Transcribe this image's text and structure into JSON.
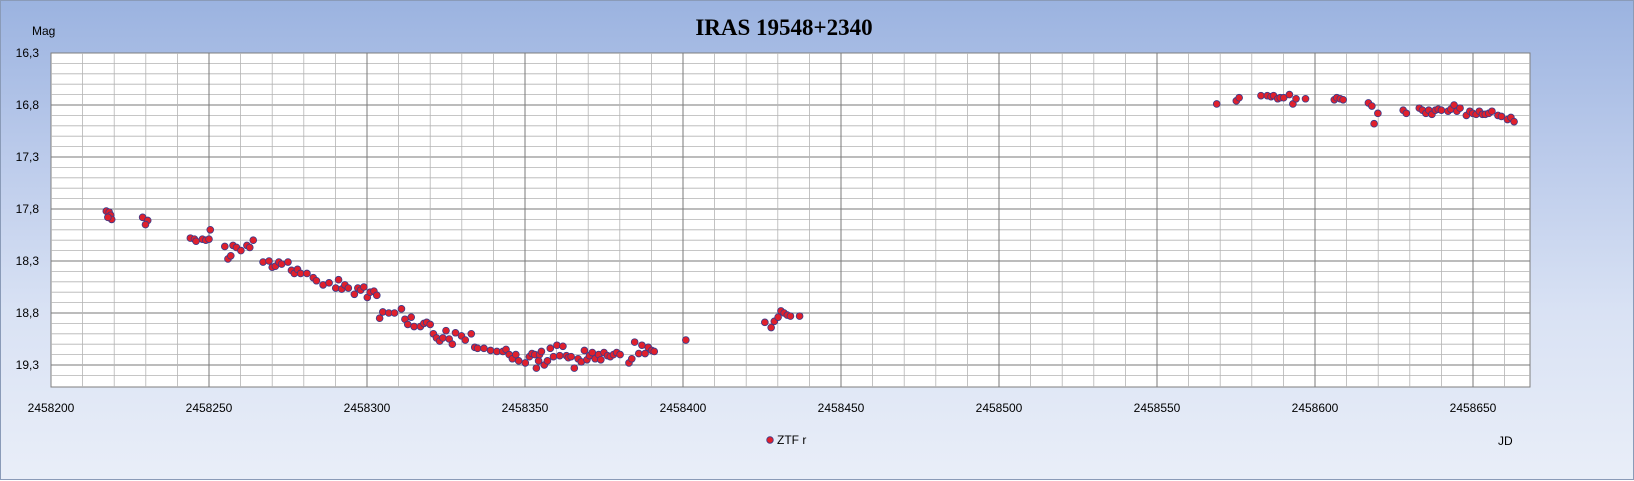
{
  "chart_data": {
    "type": "scatter",
    "title": "IRAS 19548+2340",
    "ylabel": "Mag",
    "xlabel": "JD",
    "y_inverted": true,
    "xlim": [
      2458200,
      2458670
    ],
    "ylim": [
      16.3,
      19.5
    ],
    "x_ticks": [
      "2458200",
      "2458250",
      "2458300",
      "2458350",
      "2458400",
      "2458450",
      "2458500",
      "2458550",
      "2458600",
      "2458650"
    ],
    "y_ticks": [
      "16,3",
      "16,8",
      "17,3",
      "17,8",
      "18,3",
      "18,8",
      "19,3"
    ],
    "grid": true,
    "legend_position": "bottom-center",
    "colors": {
      "marker": "#e0202c",
      "marker_edge": "#3a3a8a",
      "grid": "#9a9a9a",
      "plot_bg": "#ffffff"
    },
    "series": [
      {
        "name": "ZTF r",
        "x": [
          2458217.5,
          2458218.4,
          2458218.9,
          2458219.2,
          2458218.0,
          2458229.0,
          2458230.6,
          2458229.9,
          2458244.1,
          2458245.4,
          2458245.9,
          2458247.9,
          2458249.0,
          2458250.0,
          2458250.4,
          2458255.0,
          2458256.0,
          2458256.9,
          2458257.6,
          2458258.7,
          2458260.1,
          2458262.0,
          2458262.9,
          2458264.0,
          2458267.1,
          2458269.0,
          2458270.0,
          2458271.0,
          2458272.1,
          2458273.0,
          2458275.0,
          2458276.1,
          2458277.0,
          2458278.0,
          2458279.0,
          2458281.0,
          2458283.0,
          2458284.0,
          2458286.1,
          2458288.0,
          2458290.1,
          2458291.0,
          2458292.0,
          2458293.0,
          2458294.1,
          2458296.0,
          2458297.1,
          2458298.0,
          2458299.0,
          2458300.1,
          2458301.0,
          2458302.2,
          2458303.1,
          2458304.0,
          2458305.0,
          2458306.9,
          2458308.7,
          2458310.9,
          2458312.0,
          2458312.9,
          2458314.0,
          2458314.9,
          2458316.9,
          2458318.0,
          2458318.9,
          2458320.0,
          2458321.0,
          2458322.0,
          2458323.0,
          2458324.0,
          2458325.0,
          2458326.0,
          2458327.0,
          2458328.0,
          2458329.9,
          2458331.1,
          2458333.0,
          2458334.1,
          2458335.0,
          2458337.0,
          2458339.1,
          2458341.1,
          2458343.0,
          2458344.0,
          2458345.0,
          2458346.0,
          2458347.1,
          2458348.0,
          2458350.1,
          2458351.4,
          2458352.2,
          2458353.1,
          2458353.6,
          2458354.3,
          2458354.6,
          2458355.2,
          2458356.1,
          2458357.1,
          2458358.0,
          2458359.0,
          2458360.1,
          2458361.0,
          2458362.0,
          2458363.1,
          2458363.7,
          2458364.6,
          2458365.6,
          2458366.8,
          2458367.8,
          2458368.8,
          2458369.6,
          2458370.4,
          2458371.3,
          2458372.2,
          2458373.3,
          2458374.0,
          2458375.0,
          2458376.1,
          2458377.0,
          2458378.0,
          2458379.0,
          2458380.1,
          2458382.9,
          2458383.8,
          2458384.7,
          2458386.0,
          2458387.0,
          2458388.0,
          2458389.0,
          2458390.1,
          2458390.9,
          2458400.9,
          2458425.9,
          2458427.9,
          2458428.9,
          2458430.1,
          2458431.0,
          2458432.0,
          2458433.0,
          2458434.0,
          2458436.9,
          2458568.9,
          2458575.1,
          2458576.0,
          2458582.9,
          2458584.9,
          2458586.1,
          2458586.9,
          2458588.2,
          2458589.0,
          2458590.1,
          2458591.9,
          2458593.0,
          2458594.0,
          2458597.0,
          2458606.1,
          2458606.9,
          2458608.0,
          2458608.9,
          2458616.9,
          2458618.0,
          2458618.7,
          2458619.9,
          2458627.9,
          2458628.9,
          2458633.0,
          2458634.0,
          2458635.1,
          2458636.0,
          2458637.0,
          2458638.1,
          2458639.0,
          2458640.0,
          2458642.1,
          2458643.0,
          2458644.0,
          2458644.9,
          2458645.9,
          2458647.9,
          2458649.0,
          2458649.9,
          2458651.0,
          2458652.0,
          2458653.0,
          2458653.9,
          2458655.0,
          2458656.0,
          2458657.9,
          2458659.0,
          2458660.9,
          2458662.0,
          2458663.0
        ],
        "y": [
          17.82,
          17.83,
          17.86,
          17.9,
          17.88,
          17.88,
          17.91,
          17.95,
          18.08,
          18.09,
          18.11,
          18.09,
          18.1,
          18.09,
          18.0,
          18.16,
          18.28,
          18.25,
          18.15,
          18.17,
          18.2,
          18.15,
          18.17,
          18.1,
          18.31,
          18.3,
          18.36,
          18.35,
          18.31,
          18.33,
          18.31,
          18.39,
          18.42,
          18.38,
          18.42,
          18.42,
          18.46,
          18.49,
          18.53,
          18.51,
          18.56,
          18.48,
          18.57,
          18.53,
          18.56,
          18.62,
          18.56,
          18.58,
          18.55,
          18.65,
          18.6,
          18.59,
          18.63,
          18.85,
          18.79,
          18.8,
          18.8,
          18.76,
          18.86,
          18.91,
          18.84,
          18.93,
          18.93,
          18.9,
          18.89,
          18.91,
          19.0,
          19.04,
          19.07,
          19.04,
          18.97,
          19.05,
          19.1,
          18.99,
          19.02,
          19.06,
          19.0,
          19.13,
          19.14,
          19.14,
          19.16,
          19.17,
          19.17,
          19.15,
          19.2,
          19.24,
          19.2,
          19.26,
          19.28,
          19.22,
          19.19,
          19.2,
          19.33,
          19.26,
          19.2,
          19.17,
          19.3,
          19.26,
          19.14,
          19.22,
          19.11,
          19.21,
          19.12,
          19.21,
          19.23,
          19.22,
          19.33,
          19.24,
          19.27,
          19.16,
          19.25,
          19.21,
          19.18,
          19.24,
          19.2,
          19.25,
          19.18,
          19.21,
          19.22,
          19.2,
          19.18,
          19.2,
          19.28,
          19.24,
          19.08,
          19.19,
          19.11,
          19.19,
          19.13,
          19.16,
          19.17,
          19.06,
          18.89,
          18.94,
          18.88,
          18.84,
          18.78,
          18.8,
          18.82,
          18.83,
          18.83,
          16.79,
          16.76,
          16.73,
          16.71,
          16.71,
          16.72,
          16.71,
          16.74,
          16.73,
          16.73,
          16.7,
          16.79,
          16.74,
          16.74,
          16.75,
          16.73,
          16.74,
          16.75,
          16.78,
          16.81,
          16.98,
          16.88,
          16.85,
          16.88,
          16.83,
          16.85,
          16.88,
          16.85,
          16.89,
          16.85,
          16.84,
          16.85,
          16.86,
          16.84,
          16.8,
          16.86,
          16.83,
          16.9,
          16.86,
          16.88,
          16.89,
          16.86,
          16.89,
          16.89,
          16.88,
          16.86,
          16.9,
          16.91,
          16.94,
          16.92,
          16.96
        ]
      }
    ]
  }
}
